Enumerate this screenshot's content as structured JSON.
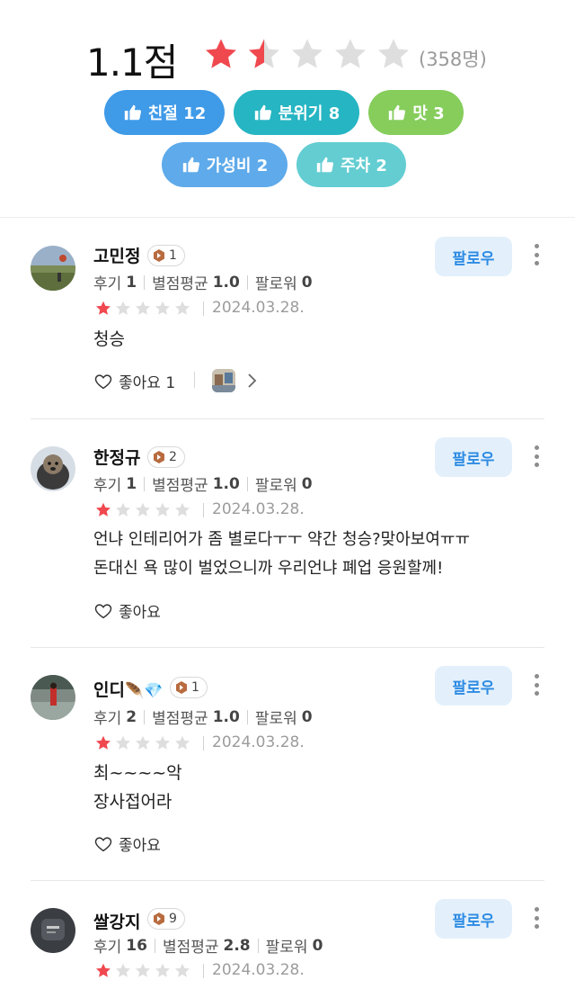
{
  "summary": {
    "score": "1.1점",
    "count": "(358명)",
    "rating_filled_fraction": 0.22,
    "tags": [
      {
        "label": "친절 12",
        "color": "#3f9ae8"
      },
      {
        "label": "분위기 8",
        "color": "#26b5c2"
      },
      {
        "label": "맛 3",
        "color": "#86cd5c"
      },
      {
        "label": "가성비 2",
        "color": "#5eaaea"
      },
      {
        "label": "주차 2",
        "color": "#63cdd2"
      }
    ],
    "icon": "thumbs-up-icon"
  },
  "colors": {
    "star_red": "#f0484f",
    "star_gray": "#dedede",
    "follow_text": "#2e8be3",
    "follow_bg": "#e3f0fb"
  },
  "follow_label": "팔로우",
  "stat_labels": {
    "reviews": "후기",
    "avg": "별점평균",
    "followers": "팔로워"
  },
  "reviews": [
    {
      "name": "고민정",
      "level": "1",
      "reviews": "1",
      "avg": "1.0",
      "followers": "0",
      "rating": 1,
      "date": "2024.03.28.",
      "lines": [
        "청승"
      ],
      "like_label": "좋아요 1",
      "has_photo": true
    },
    {
      "name": "한정규",
      "level": "2",
      "reviews": "1",
      "avg": "1.0",
      "followers": "0",
      "rating": 1,
      "date": "2024.03.28.",
      "lines": [
        "언냐 인테리어가 좀 별로다ㅜㅜ 약간 청승?맞아보여ㅠㅠ",
        "돈대신 욕 많이 벌었으니까 우리언냐 폐업 응원할께!"
      ],
      "like_label": "좋아요",
      "has_photo": false
    },
    {
      "name": "인디",
      "name_suffix": "🪶💎",
      "level": "1",
      "reviews": "2",
      "avg": "1.0",
      "followers": "0",
      "rating": 1,
      "date": "2024.03.28.",
      "lines": [
        "최~~~~악",
        "장사접어라"
      ],
      "like_label": "좋아요",
      "has_photo": false
    },
    {
      "name": "쌀강지",
      "level": "9",
      "reviews": "16",
      "avg": "2.8",
      "followers": "0",
      "rating": 1,
      "date": "2024.03.28.",
      "lines": [],
      "like_label": "",
      "has_photo": false
    }
  ]
}
